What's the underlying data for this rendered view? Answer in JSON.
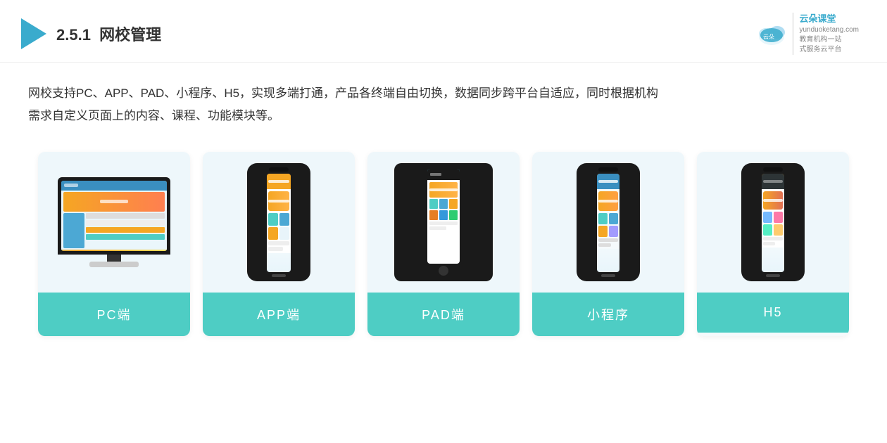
{
  "header": {
    "section_number": "2.5.1",
    "section_title": "网校管理",
    "brand": {
      "name": "云朵课堂",
      "domain": "yunduoketang.com",
      "tagline1": "教育机构一站",
      "tagline2": "式服务云平台"
    }
  },
  "description": {
    "text1": "网校支持PC、APP、PAD、小程序、H5，实现多端打通，产品各终端自由切换，数据同步跨平台自适应，同时根据机构",
    "text2": "需求自定义页面上的内容、课程、功能模块等。"
  },
  "cards": [
    {
      "id": "pc",
      "label": "PC端",
      "type": "pc"
    },
    {
      "id": "app",
      "label": "APP端",
      "type": "phone"
    },
    {
      "id": "pad",
      "label": "PAD端",
      "type": "tablet"
    },
    {
      "id": "mini",
      "label": "小程序",
      "type": "phone"
    },
    {
      "id": "h5",
      "label": "H5",
      "type": "phone"
    }
  ]
}
